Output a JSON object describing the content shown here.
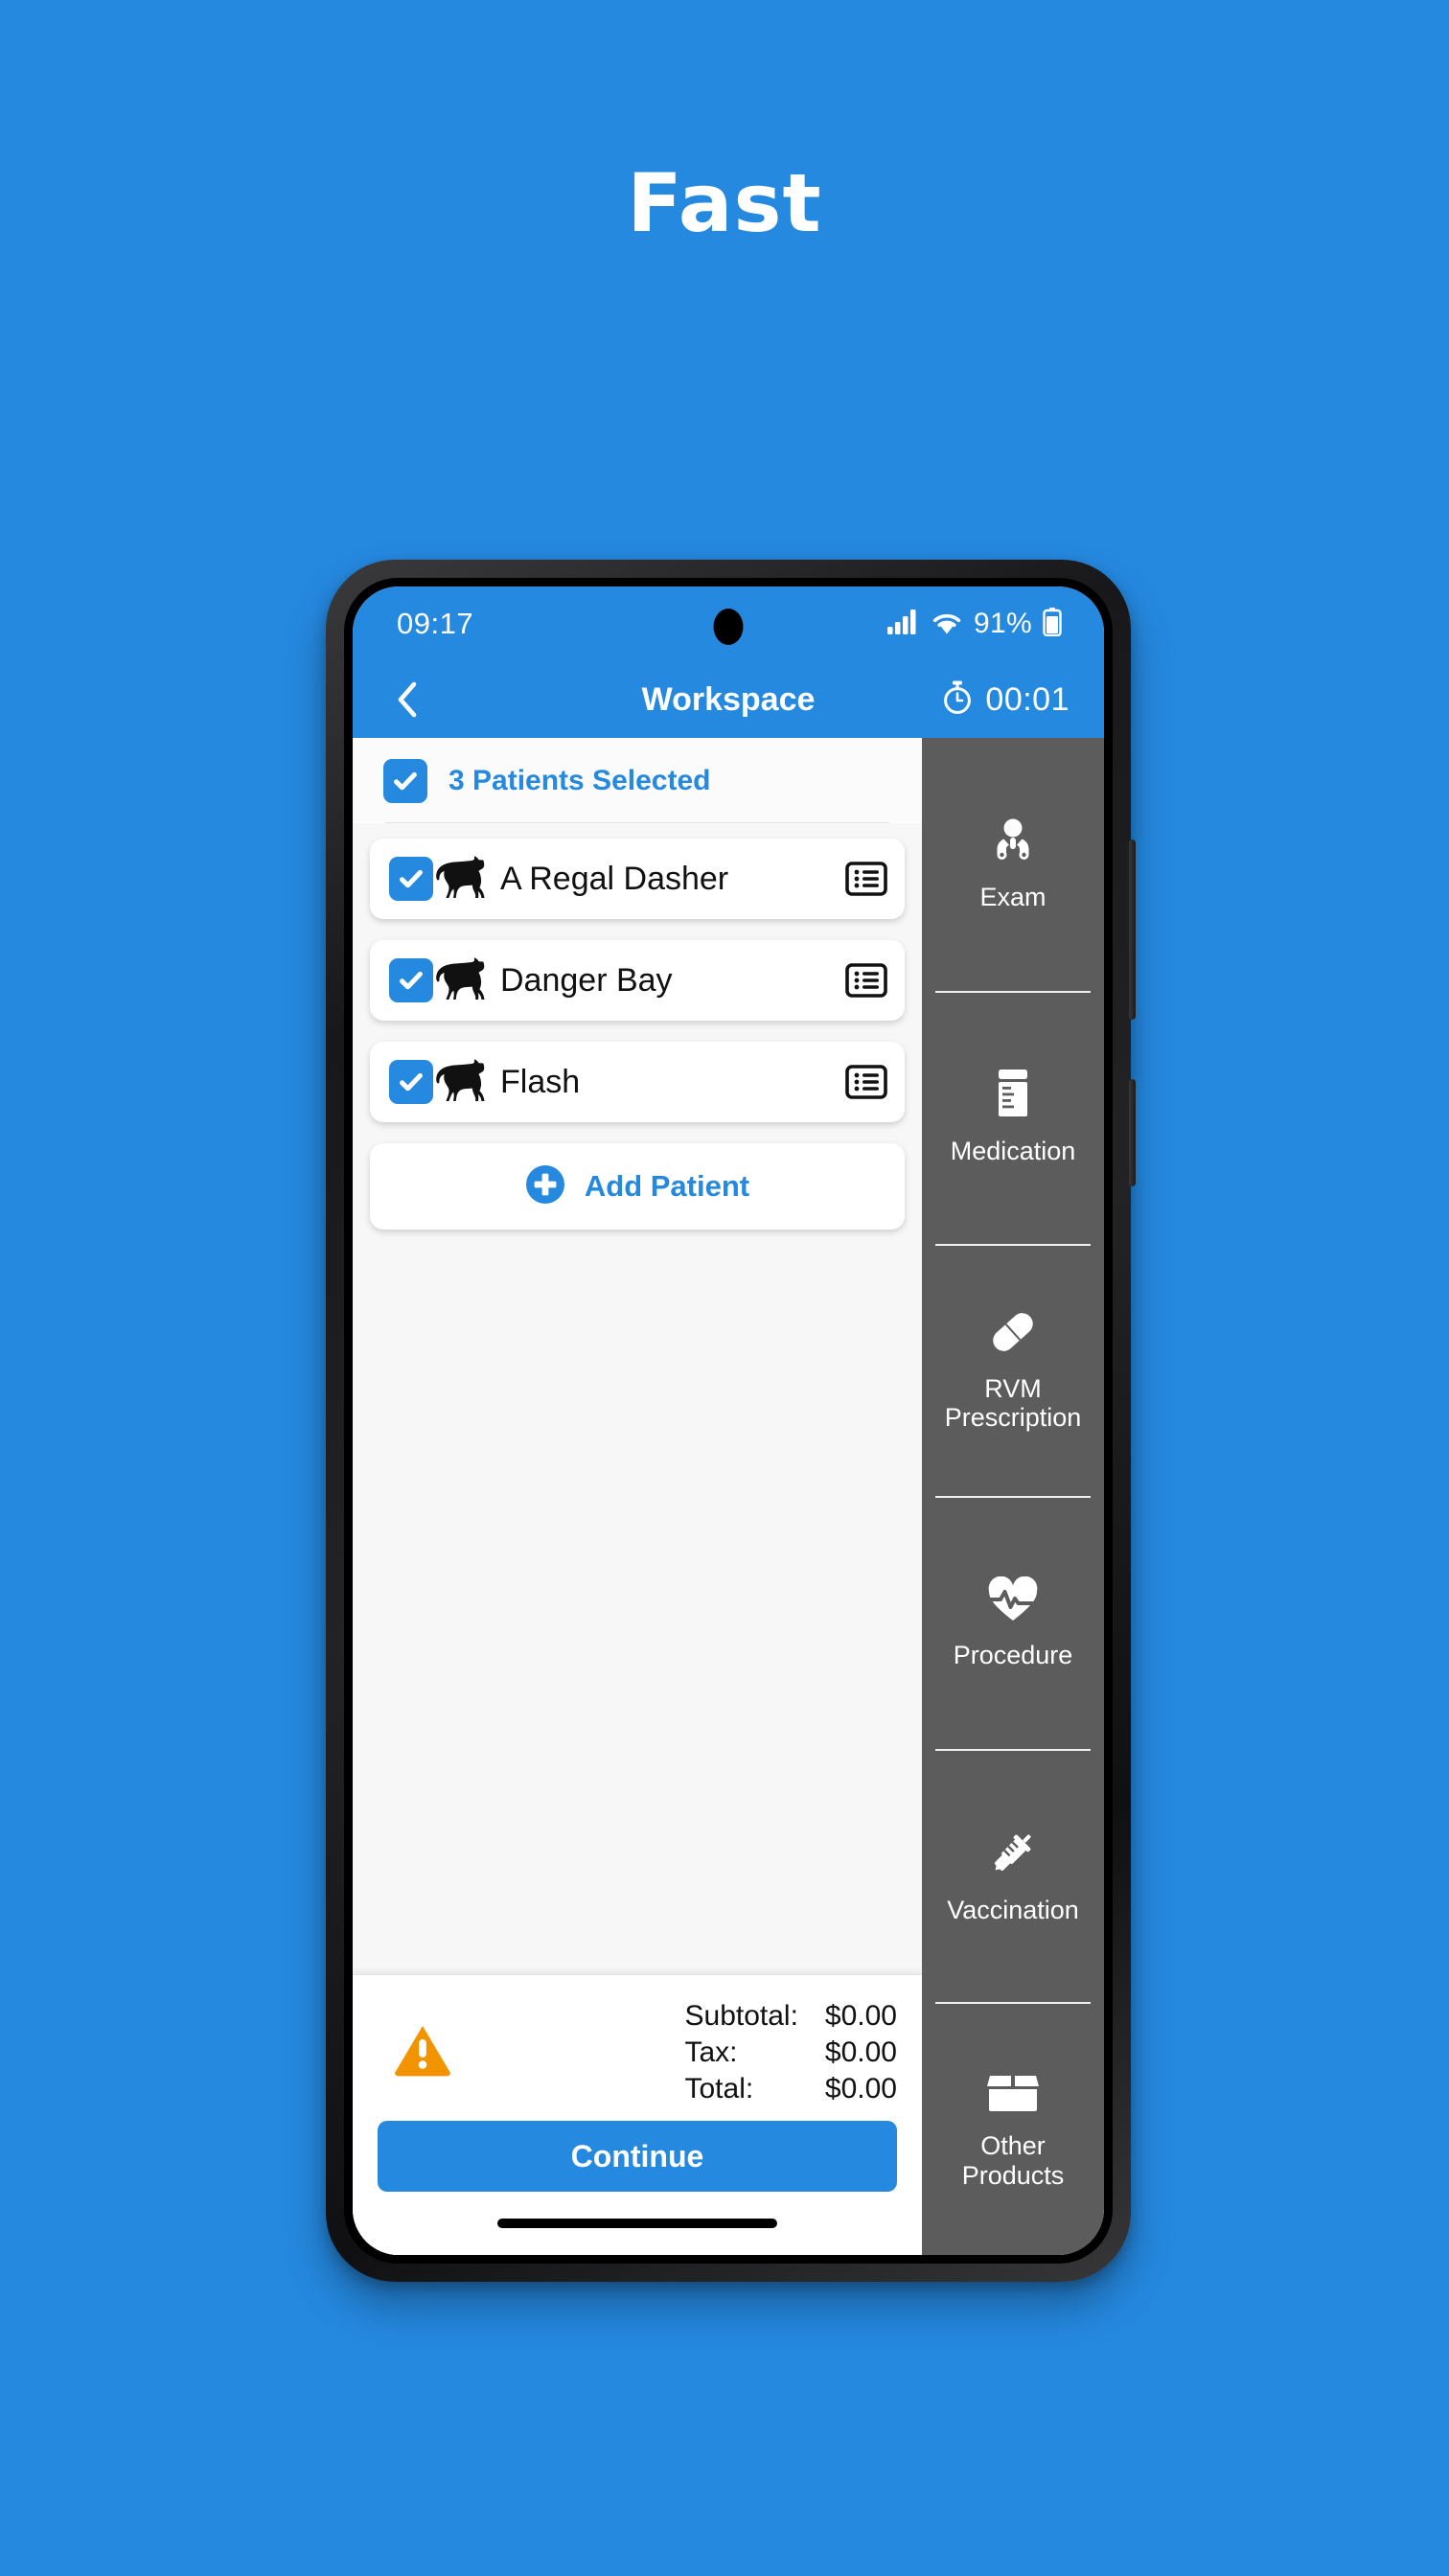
{
  "headline": "Fast",
  "theme": {
    "background": "#2589e0",
    "accent": "#2589e0",
    "sidebar_bg": "#5c5c5c",
    "warning": "#f29400"
  },
  "status_bar": {
    "time": "09:17",
    "battery_percent": "91%",
    "signal_icon": "cellular-signal-icon",
    "wifi_icon": "wifi-icon",
    "battery_icon": "battery-icon"
  },
  "app_bar": {
    "back_icon": "back-chevron-icon",
    "title": "Workspace",
    "timer_icon": "stopwatch-icon",
    "timer_value": "00:01"
  },
  "select_all": {
    "label": "3 Patients Selected",
    "checked": true,
    "checkbox_icon": "checkbox-checked-icon"
  },
  "patients": [
    {
      "name": "A Regal Dasher",
      "checked": true,
      "species_icon": "horse-icon",
      "detail_icon": "list-details-icon"
    },
    {
      "name": "Danger Bay",
      "checked": true,
      "species_icon": "horse-icon",
      "detail_icon": "list-details-icon"
    },
    {
      "name": "Flash",
      "checked": true,
      "species_icon": "horse-icon",
      "detail_icon": "list-details-icon"
    }
  ],
  "add_patient": {
    "label": "Add Patient",
    "icon": "plus-circle-icon"
  },
  "sidebar": {
    "items": [
      {
        "label": "Exam",
        "icon": "doctor-stethoscope-icon"
      },
      {
        "label": "Medication",
        "icon": "pill-bottle-icon"
      },
      {
        "label": "RVM\nPrescription",
        "icon": "capsule-icon"
      },
      {
        "label": "Procedure",
        "icon": "heart-pulse-icon"
      },
      {
        "label": "Vaccination",
        "icon": "syringe-icon"
      },
      {
        "label": "Other\nProducts",
        "icon": "open-box-icon"
      }
    ]
  },
  "totals": {
    "warning_icon": "warning-triangle-icon",
    "rows": [
      {
        "label": "Subtotal:",
        "value": "$0.00"
      },
      {
        "label": "Tax:",
        "value": "$0.00"
      },
      {
        "label": "Total:",
        "value": "$0.00"
      }
    ]
  },
  "continue_button": {
    "label": "Continue"
  }
}
